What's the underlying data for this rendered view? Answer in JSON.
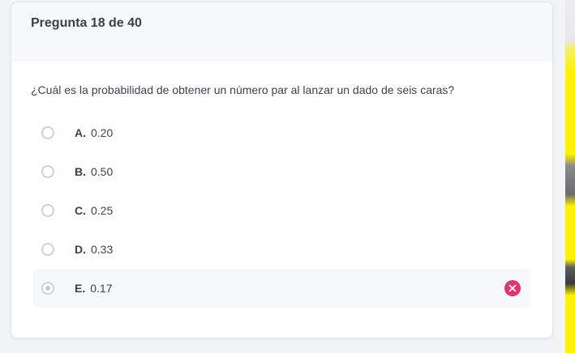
{
  "quiz": {
    "header": "Pregunta 18 de 40",
    "question": "¿Cuál es la probabilidad de obtener un número par al lanzar un dado de seis caras?",
    "options": [
      {
        "letter": "A.",
        "text": "0.20",
        "selected": false
      },
      {
        "letter": "B.",
        "text": "0.50",
        "selected": false
      },
      {
        "letter": "C.",
        "text": "0.25",
        "selected": false
      },
      {
        "letter": "D.",
        "text": "0.33",
        "selected": false
      },
      {
        "letter": "E.",
        "text": "0.17",
        "selected": true,
        "status": "incorrect"
      }
    ]
  },
  "colors": {
    "incorrect": "#e0346f",
    "side_strip_accent": "#fff200"
  },
  "icons": {
    "incorrect": "close-circle-icon"
  }
}
